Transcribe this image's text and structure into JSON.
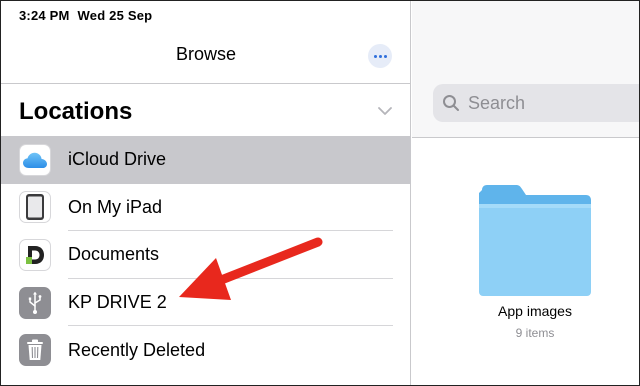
{
  "status_bar": {
    "time": "3:24 PM",
    "date": "Wed 25 Sep"
  },
  "sidebar": {
    "title": "Browse",
    "section_title": "Locations",
    "items": [
      {
        "label": "iCloud Drive",
        "icon": "icloud-icon",
        "selected": true
      },
      {
        "label": "On My iPad",
        "icon": "ipad-icon",
        "selected": false
      },
      {
        "label": "Documents",
        "icon": "documents-app-icon",
        "selected": false
      },
      {
        "label": "KP DRIVE 2",
        "icon": "usb-icon",
        "selected": false
      },
      {
        "label": "Recently Deleted",
        "icon": "trash-icon",
        "selected": false
      }
    ]
  },
  "main": {
    "search_placeholder": "Search",
    "folder": {
      "name": "App images",
      "count": "9 items"
    }
  },
  "colors": {
    "accent": "#2f6fdb",
    "selected_row": "#c8c8cc",
    "folder": "#7ec8f2",
    "annotation_arrow": "#e8281d"
  },
  "annotation": {
    "type": "arrow",
    "points_to": "KP DRIVE 2"
  }
}
